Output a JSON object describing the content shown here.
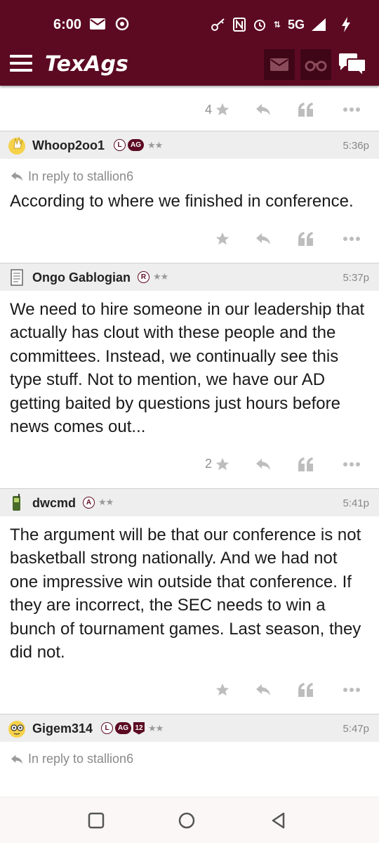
{
  "status_bar": {
    "time": "6:00",
    "network": "5G",
    "icons": [
      "mail-icon",
      "chrome-icon",
      "key-icon",
      "nfc-icon",
      "alarm-icon",
      "data-arrows-icon",
      "signal-icon",
      "charging-icon"
    ]
  },
  "app_bar": {
    "logo": "TexAgs",
    "icons": [
      "hamburger-menu-icon",
      "mail-icon",
      "binoculars-icon",
      "chat-bubbles-icon"
    ]
  },
  "top_actions": {
    "star_count": "4"
  },
  "posts": [
    {
      "username": "Whoop2oo1",
      "badges": [
        "L",
        "AG"
      ],
      "stars": "★★",
      "time": "5:36p",
      "reply_to": "In reply to stallion6",
      "body": "According to where we finished in conference.",
      "star_count": ""
    },
    {
      "username": "Ongo Gablogian",
      "badges": [
        "R"
      ],
      "stars": "★★",
      "time": "5:37p",
      "reply_to": "",
      "body": "We need to hire someone in our leadership that actually has clout with these people and the committees. Instead, we continually see this type stuff. Not to mention, we have our AD getting baited by questions just hours before news comes out...",
      "star_count": "2"
    },
    {
      "username": "dwcmd",
      "badges": [
        "A"
      ],
      "stars": "★★",
      "time": "5:41p",
      "reply_to": "",
      "body": "The argument will be that our conference is not basketball strong nationally. And we had not one impressive win outside that conference. If they are incorrect, the SEC needs to win a bunch of tournament games. Last season, they did not.",
      "star_count": ""
    },
    {
      "username": "Gigem314",
      "badges": [
        "L",
        "AG",
        "12"
      ],
      "stars": "★★",
      "time": "5:47p",
      "reply_to": "In reply to stallion6"
    }
  ],
  "colors": {
    "maroon": "#5c0a22",
    "header_gray": "#eeeeee",
    "icon_gray": "#b8b8b8"
  },
  "nav_bar": {
    "icons": [
      "recents-square-icon",
      "home-circle-icon",
      "back-triangle-icon"
    ]
  }
}
